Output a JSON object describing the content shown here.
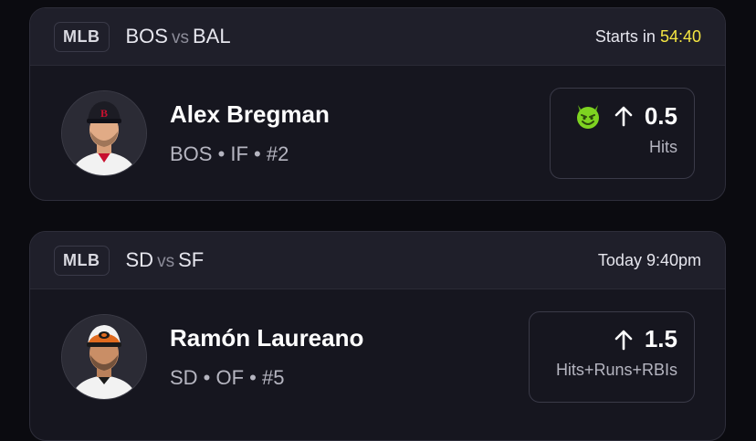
{
  "cards": [
    {
      "league": "MLB",
      "team_home": "BOS",
      "vs": "vs",
      "team_away": "BAL",
      "time_prefix": "Starts in",
      "countdown": "54:40",
      "player_name": "Alex Bregman",
      "player_info": "BOS • IF • #2",
      "projection_value": "0.5",
      "projection_stat": "Hits",
      "direction_icon": "arrow-up-icon",
      "modifier_icon": "devil-icon",
      "cap_color": "#1c1c24",
      "jersey_color": "#f2f2f2"
    },
    {
      "league": "MLB",
      "team_home": "SD",
      "vs": "vs",
      "team_away": "SF",
      "time": "Today 9:40pm",
      "player_name": "Ramón Laureano",
      "player_info": "SD • OF • #5",
      "projection_value": "1.5",
      "projection_stat": "Hits+Runs+RBIs",
      "direction_icon": "arrow-up-icon",
      "cap_color": "#e06b1f",
      "jersey_color": "#f2f2f2"
    }
  ],
  "colors": {
    "background": "#0b0b10",
    "card": "#16161f",
    "header": "#1f1f2a",
    "countdown": "#f5e642",
    "devil": "#7ed321"
  }
}
